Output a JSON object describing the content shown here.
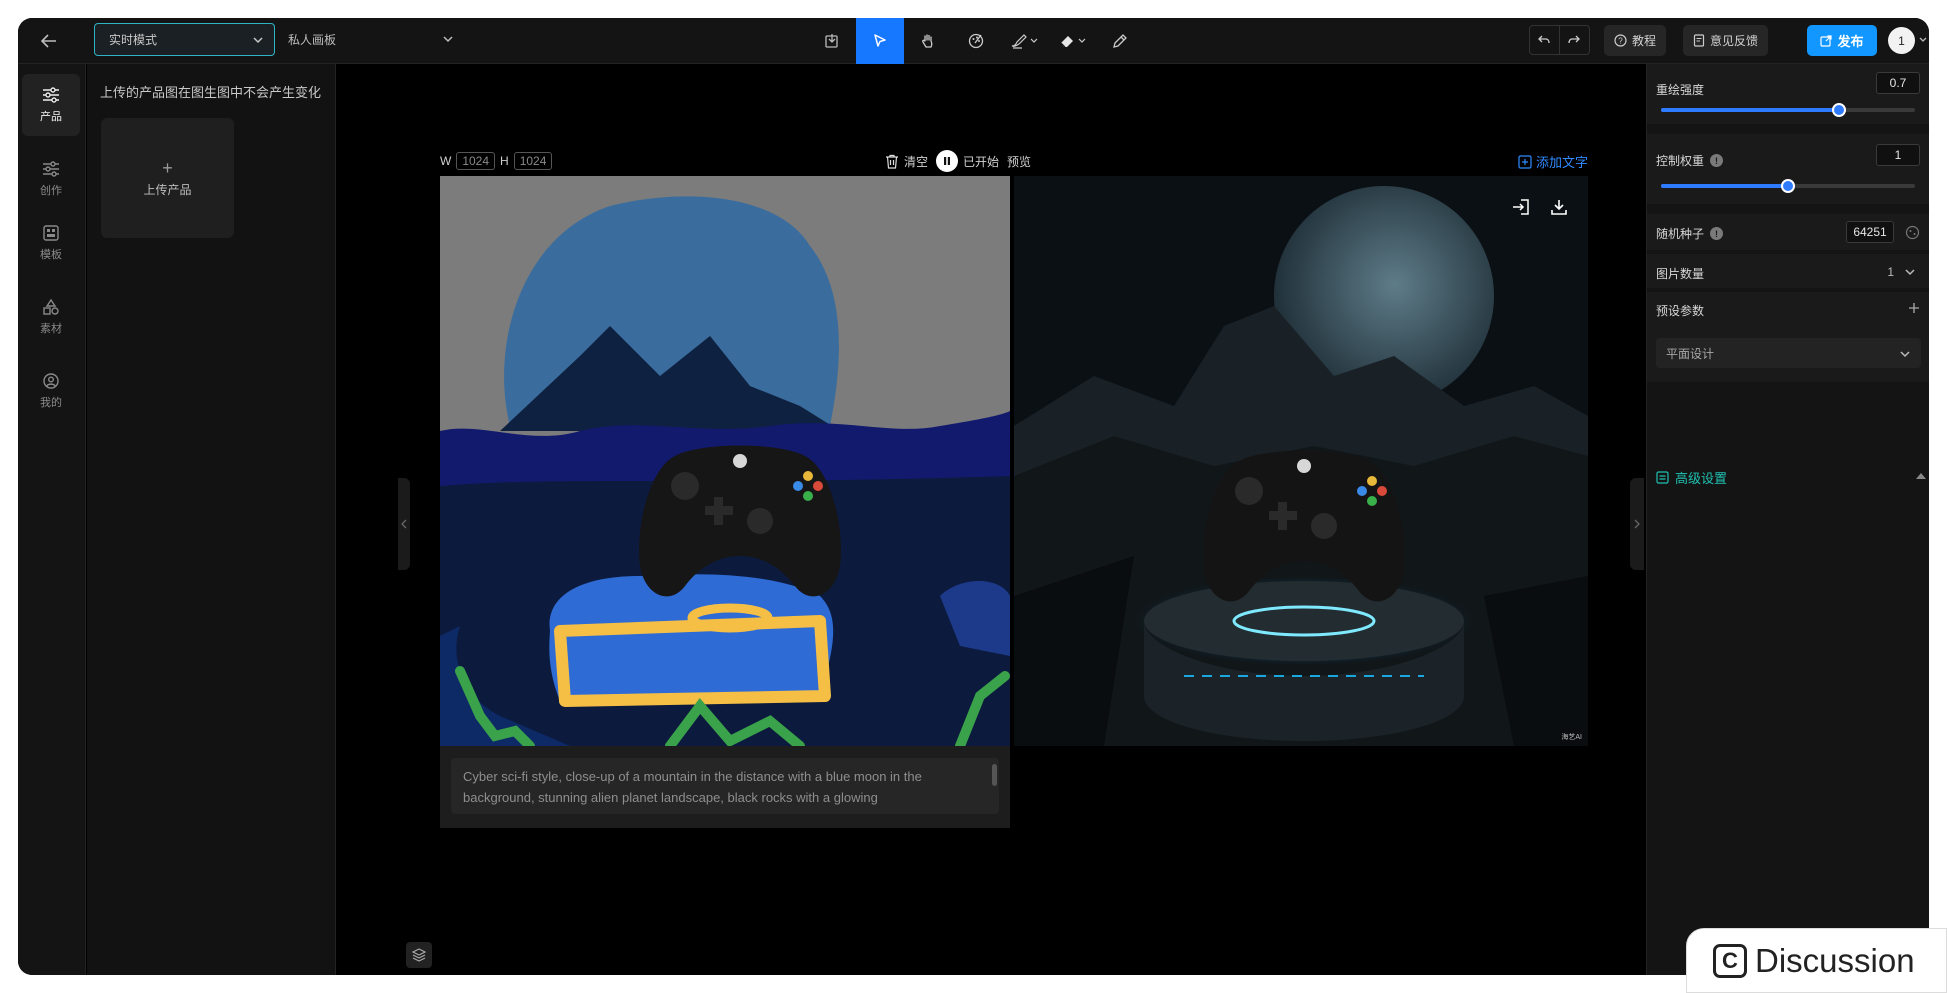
{
  "topbar": {
    "mode_label": "实时模式",
    "board_label": "私人画板",
    "tutorial_label": "教程",
    "feedback_label": "意见反馈",
    "publish_label": "发布",
    "avatar_text": "1"
  },
  "tools": [
    "import-icon",
    "pointer-icon",
    "hand-icon",
    "palette-icon",
    "brush-icon",
    "eraser-icon",
    "pen-icon"
  ],
  "rail": [
    {
      "label": "产品",
      "icon": "sliders-icon"
    },
    {
      "label": "创作",
      "icon": "sliders-icon"
    },
    {
      "label": "模板",
      "icon": "template-icon"
    },
    {
      "label": "素材",
      "icon": "shapes-icon"
    },
    {
      "label": "我的",
      "icon": "user-icon"
    }
  ],
  "left_panel": {
    "hint": "上传的产品图在图生图中不会产生变化",
    "upload_label": "上传产品"
  },
  "canvas": {
    "w_label": "W",
    "width": "1024",
    "h_label": "H",
    "height": "1024",
    "clear_label": "清空",
    "started_label": "已开始",
    "preview_label": "预览",
    "add_text_label": "添加文字",
    "prompt": "Cyber sci-fi style, close-up of a mountain in the distance with a blue moon in the background, stunning alien planet landscape, black rocks with a glowing",
    "watermark": "海艺AI"
  },
  "settings": {
    "redraw_label": "重绘强度",
    "redraw_value": "0.7",
    "redraw_fraction": 0.7,
    "control_label": "控制权重",
    "control_value": "1",
    "control_fraction": 0.5,
    "seed_label": "随机种子",
    "seed_value": "64251",
    "count_label": "图片数量",
    "count_value": "1",
    "preset_label": "预设参数",
    "preset_value": "平面设计",
    "advanced_label": "高级设置"
  },
  "discussion_label": "Discussion",
  "colors": {
    "accent": "#1677ff",
    "publish": "#1296ff",
    "teal": "#1fc1b1"
  }
}
